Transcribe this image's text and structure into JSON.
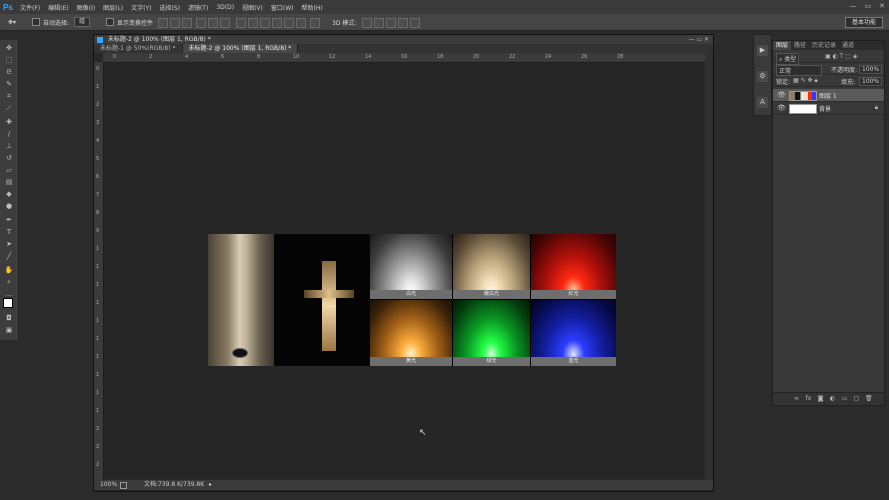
{
  "app": {
    "logo": "Ps"
  },
  "menu": [
    "文件(F)",
    "编辑(E)",
    "图像(I)",
    "图层(L)",
    "文字(Y)",
    "选择(S)",
    "滤镜(T)",
    "3D(D)",
    "视图(V)",
    "窗口(W)",
    "帮助(H)"
  ],
  "options_bar": {
    "auto_select_label": "自动选择:",
    "auto_select_value": "组",
    "show_transform_label": "显示变换控件",
    "mode_3d_label": "3D 模式:",
    "workspace_button": "基本功能"
  },
  "document": {
    "window_title": "未标题-2 @ 100% (图层 1, RGB/8) *",
    "tabs": [
      "未标题-1 @ 50%(RGB/8) *",
      "未标题-2 @ 100% (图层 1, RGB/8) *"
    ],
    "ruler_marks": [
      "0",
      "2",
      "4",
      "6",
      "8",
      "10",
      "12",
      "14",
      "16",
      "18",
      "20",
      "22",
      "24",
      "26",
      "28"
    ],
    "ruler_marks_left": [
      "0",
      "1",
      "2",
      "3",
      "4",
      "5",
      "6",
      "7",
      "8",
      "9",
      "1",
      "1",
      "1",
      "1",
      "1",
      "1",
      "1",
      "1",
      "1",
      "1",
      "2",
      "2",
      "2"
    ],
    "zoom": "100%",
    "doc_size": "文档:739.8 K/739.8K"
  },
  "image_tiles": {
    "captions": [
      "白光",
      "暖白光",
      "红光",
      "黄光",
      "绿光",
      "蓝光"
    ],
    "colors": {
      "white": "#e8e8e8",
      "warm_white": "#f3e0b8",
      "red": "#ff2a10",
      "yellow": "#ffb040",
      "green": "#22ff44",
      "blue": "#2d3cff"
    }
  },
  "layers_panel": {
    "tabs": [
      "图层",
      "路径",
      "历史记录",
      "通道"
    ],
    "filter_kind": "类型",
    "blend_mode": "正常",
    "opacity_label": "不透明度:",
    "opacity_value": "100%",
    "lock_label": "锁定:",
    "fill_label": "填充:",
    "fill_value": "100%",
    "layers": [
      {
        "name": "图层 1",
        "selected": true
      },
      {
        "name": "背景",
        "selected": false
      }
    ]
  },
  "accent_color": "#31a8ff"
}
